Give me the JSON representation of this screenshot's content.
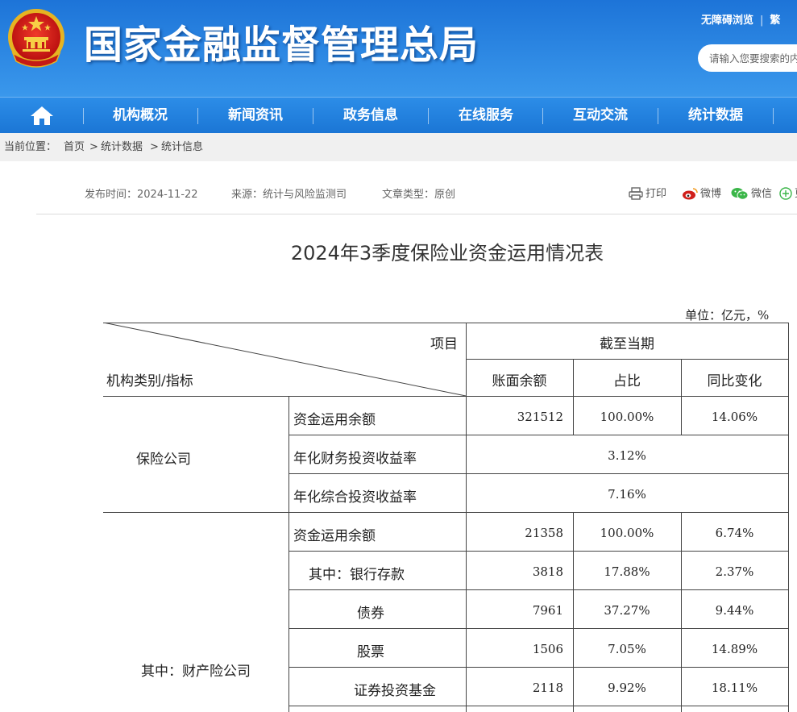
{
  "header": {
    "site_title": "国家金融监督管理总局",
    "top_links": [
      "无障碍浏览",
      "繁"
    ],
    "search_placeholder": "请输入您要搜索的内容"
  },
  "nav": {
    "home_icon": "home-icon",
    "items": [
      "机构概况",
      "新闻资讯",
      "政务信息",
      "在线服务",
      "互动交流",
      "统计数据"
    ]
  },
  "breadcrumb": {
    "label": "当前位置：",
    "items": [
      "首页",
      "统计数据",
      "统计信息"
    ],
    "separator": ">"
  },
  "article": {
    "publish_time": "发布时间：2024-11-22",
    "source": "来源：统计与风险监测司",
    "type": "文章类型：原创",
    "share": {
      "print": "打印",
      "weibo": "微博",
      "wechat": "微信",
      "more": "更"
    },
    "title": "2024年3季度保险业资金运用情况表",
    "unit": "单位：亿元，%"
  },
  "table": {
    "header_item": "项目",
    "header_category": "机构类别/指标",
    "header_period": "截至当期",
    "columns": [
      "账面余额",
      "占比",
      "同比变化"
    ],
    "groups": [
      {
        "name": "保险公司",
        "rows": [
          {
            "indicator": "资金运用余额",
            "balance": "321512",
            "share": "100.00%",
            "yoy": "14.06%"
          },
          {
            "indicator": "年化财务投资收益率",
            "merged": "3.12%"
          },
          {
            "indicator": "年化综合投资收益率",
            "merged": "7.16%"
          }
        ]
      },
      {
        "name": "其中：财产险公司",
        "rows": [
          {
            "indicator": "资金运用余额",
            "balance": "21358",
            "share": "100.00%",
            "yoy": "6.74%"
          },
          {
            "indicator": "其中：银行存款",
            "balance": "3818",
            "share": "17.88%",
            "yoy": "2.37%"
          },
          {
            "indicator": "债券",
            "balance": "7961",
            "share": "37.27%",
            "yoy": "9.44%"
          },
          {
            "indicator": "股票",
            "balance": "1506",
            "share": "7.05%",
            "yoy": "14.89%"
          },
          {
            "indicator": "证券投资基金",
            "balance": "2118",
            "share": "9.92%",
            "yoy": "18.11%"
          }
        ]
      }
    ]
  },
  "colors": {
    "header_blue": "#1d74d8",
    "nav_blue": "#1b76d5",
    "breadcrumb_bg": "#f0f0f0",
    "print_red": "#d0201b",
    "wechat_green": "#3bb649"
  }
}
